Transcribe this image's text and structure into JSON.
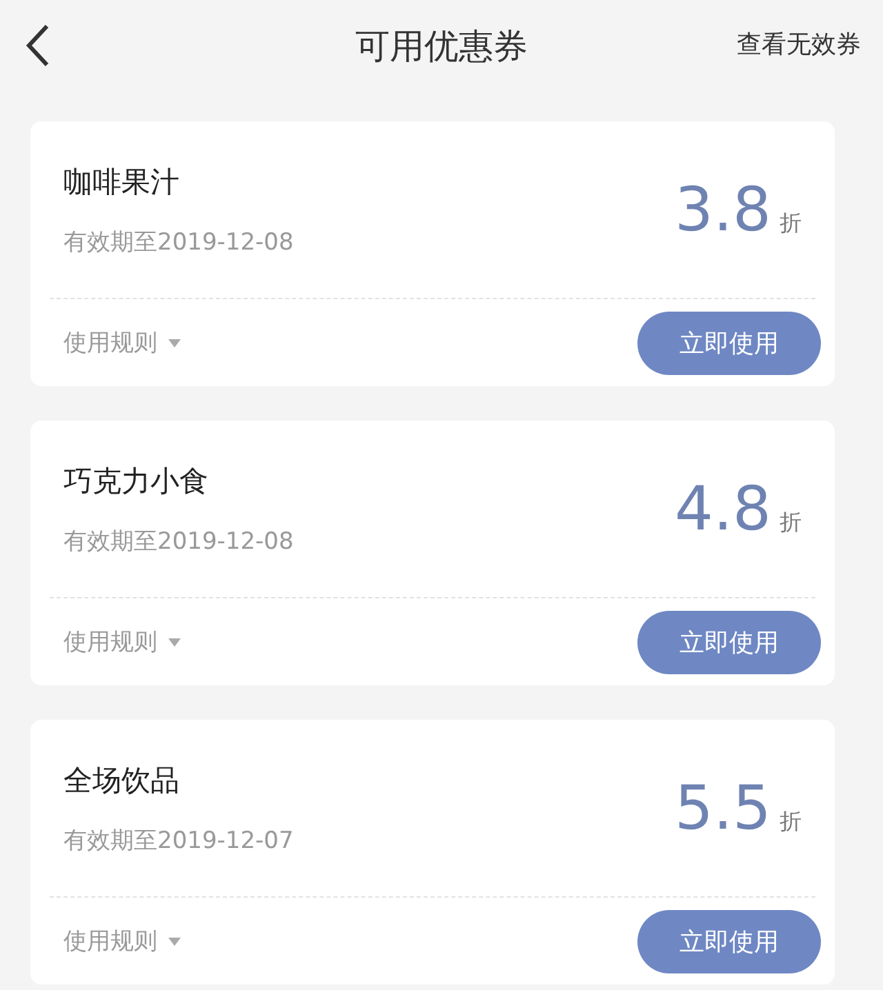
{
  "header": {
    "title": "可用优惠券",
    "action": "查看无效券"
  },
  "coupons": [
    {
      "name": "咖啡果汁",
      "validity": "有效期至2019-12-08",
      "discount": "3.8",
      "unit": "折",
      "rules": "使用规则",
      "button": "立即使用"
    },
    {
      "name": "巧克力小食",
      "validity": "有效期至2019-12-08",
      "discount": "4.8",
      "unit": "折",
      "rules": "使用规则",
      "button": "立即使用"
    },
    {
      "name": "全场饮品",
      "validity": "有效期至2019-12-07",
      "discount": "5.5",
      "unit": "折",
      "rules": "使用规则",
      "button": "立即使用"
    }
  ]
}
